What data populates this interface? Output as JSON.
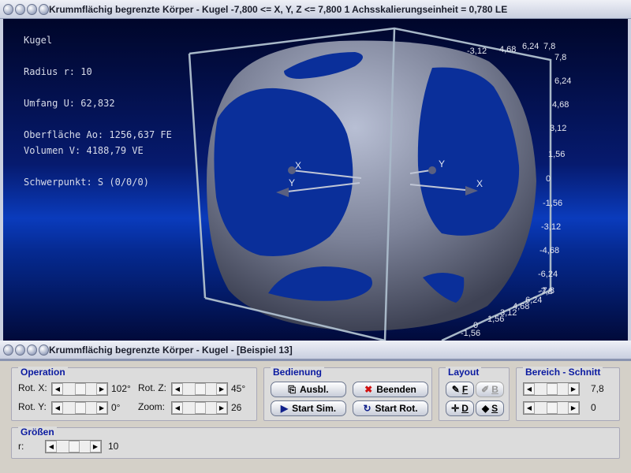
{
  "window": {
    "title": "Krummflächig begrenzte Körper - Kugel   -7,800 <= X, Y, Z <= 7,800    1 Achsskalierungseinheit = 0,780 LE"
  },
  "info": {
    "name": "Kugel",
    "radius": "Radius r: 10",
    "umfang": "Umfang U: 62,832",
    "oberflaeche": "Oberfläche Ao: 1256,637 FE",
    "volumen": "Volumen V: 4188,79 VE",
    "schwerpunkt": "Schwerpunkt: S (0/0/0)"
  },
  "axis_ticks": [
    "7,8",
    "6,24",
    "4,68",
    "3,12",
    "1,56",
    "0",
    "-1,56",
    "-3,12",
    "-4,68",
    "-6,24",
    "-7,8"
  ],
  "axis_ticks_top": [
    "-3,12",
    "4,68",
    "6,24",
    "7,8"
  ],
  "axis_ticks_bottom": [
    "-7,8",
    "6,24",
    "4,68",
    "3,12",
    "1,56",
    "0",
    "-1,56"
  ],
  "axis_labels": {
    "x": "X",
    "y": "Y"
  },
  "panel_window": {
    "title": "Krummflächig begrenzte Körper - Kugel - [Beispiel 13]"
  },
  "operation": {
    "title": "Operation",
    "rotx_label": "Rot. X:",
    "rotx_value": "102°",
    "roty_label": "Rot. Y:",
    "roty_value": "0°",
    "rotz_label": "Rot. Z:",
    "rotz_value": "45°",
    "zoom_label": "Zoom:",
    "zoom_value": "26"
  },
  "bedienung": {
    "title": "Bedienung",
    "ausbl": "Ausbl.",
    "beenden": "Beenden",
    "start_sim": "Start Sim.",
    "start_rot": "Start Rot."
  },
  "layout": {
    "title": "Layout",
    "f": "F",
    "b": "B",
    "d": "D",
    "s": "S"
  },
  "bereich": {
    "title": "Bereich - Schnitt",
    "value1": "7,8",
    "value2": "0"
  },
  "groessen": {
    "title": "Größen",
    "r_label": "r:",
    "r_value": "10"
  },
  "colors": {
    "group_title": "#0a1aa0",
    "body": "#8a90a8",
    "background": "#0a3bbc"
  }
}
